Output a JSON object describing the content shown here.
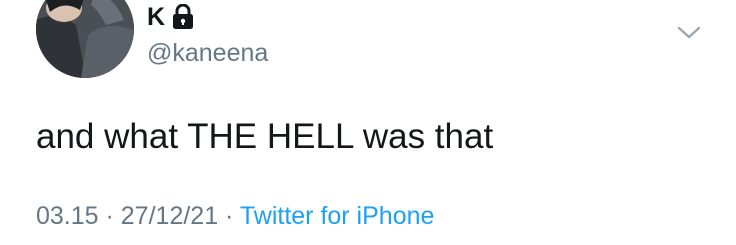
{
  "user": {
    "display_name": "K",
    "handle": "@kaneena",
    "protected_icon": "lock-icon"
  },
  "menu": {
    "icon": "chevron-down-icon"
  },
  "tweet": {
    "text": "and what THE HELL was that"
  },
  "meta": {
    "time": "03.15",
    "separator1": " · ",
    "date": "27/12/21",
    "separator2": " · ",
    "source": "Twitter for iPhone"
  },
  "colors": {
    "text_primary": "#14171a",
    "text_secondary": "#657786",
    "link": "#1da1f2"
  }
}
